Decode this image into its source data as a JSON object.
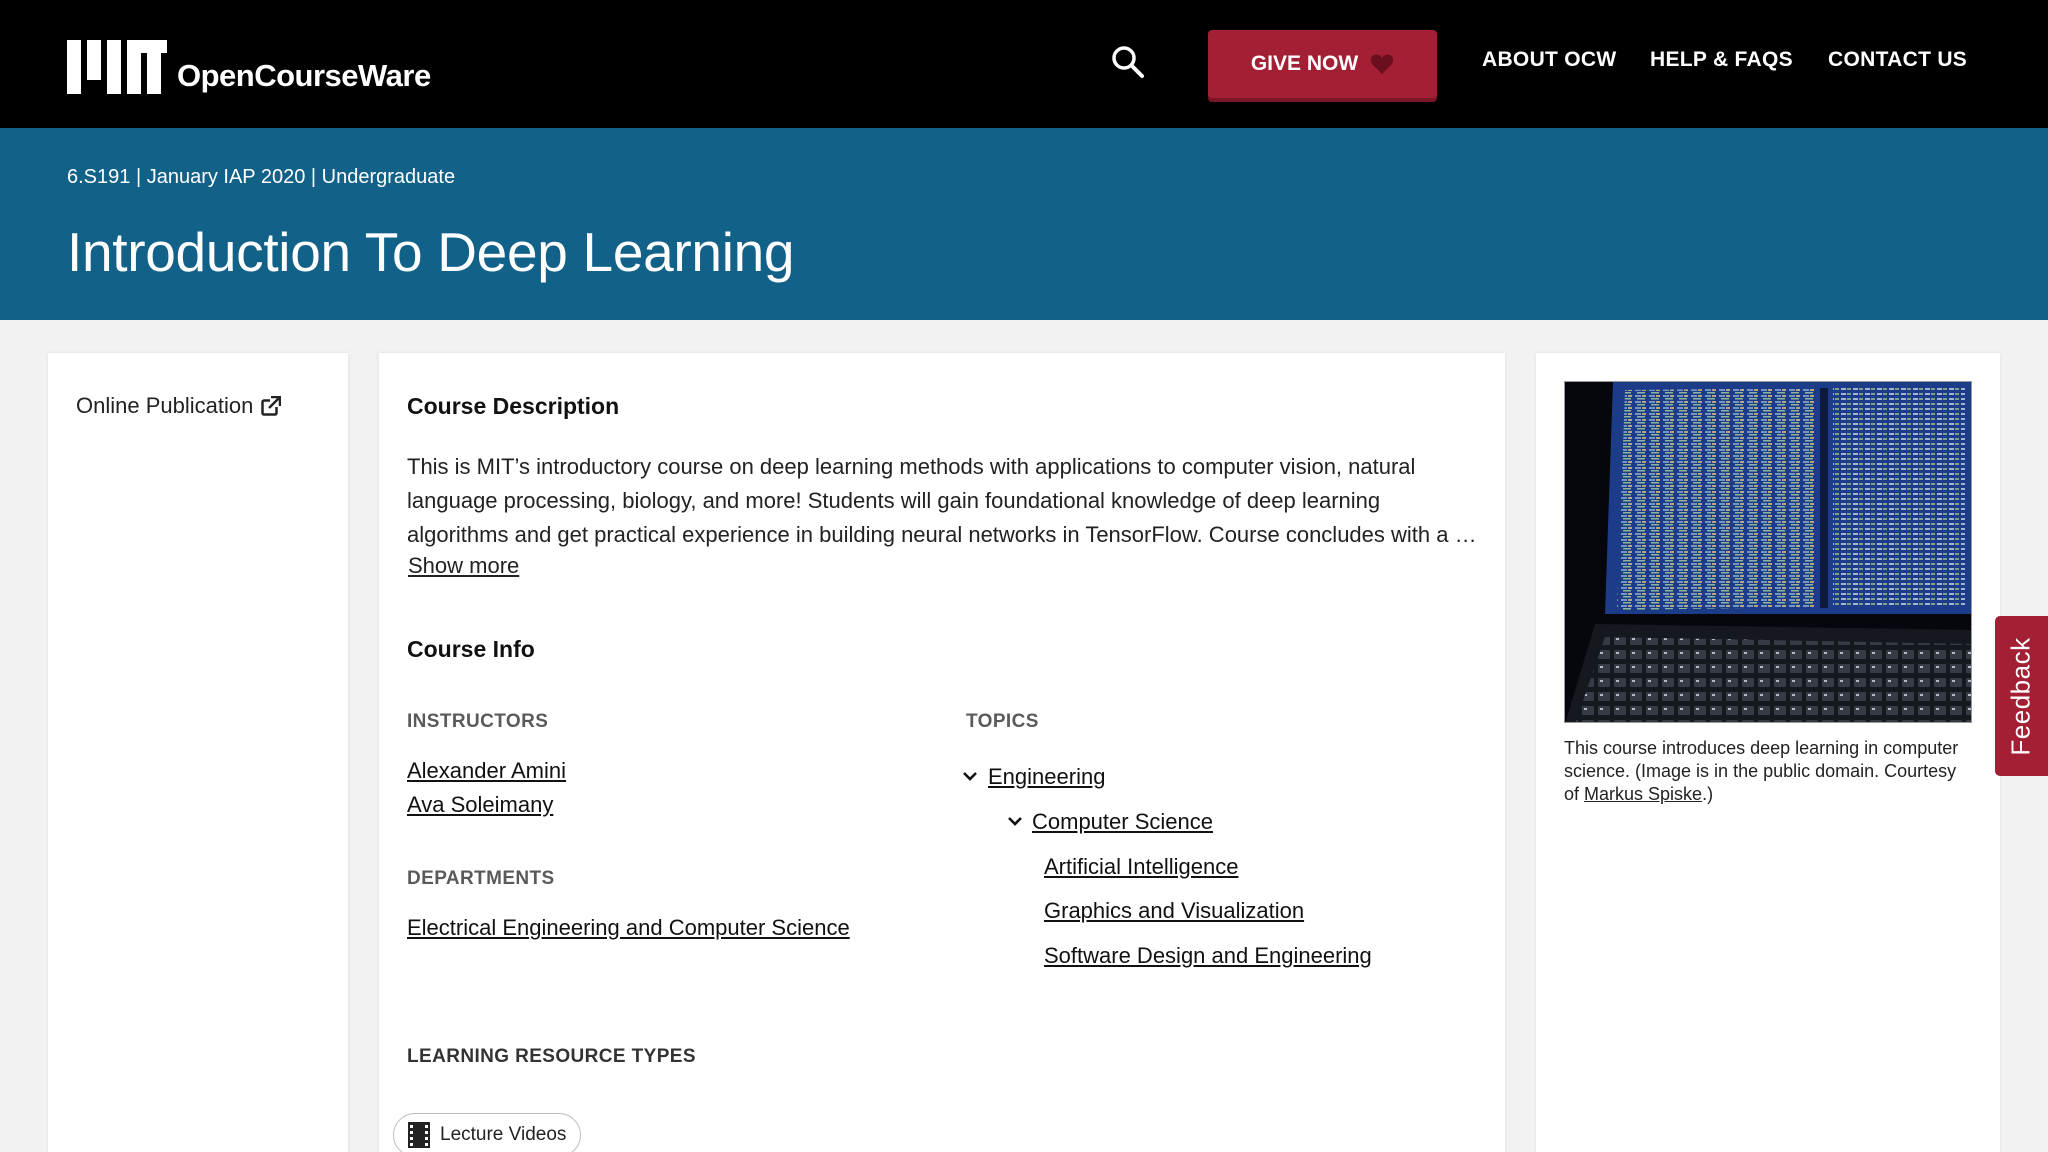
{
  "header": {
    "logo_text": "OpenCourseWare",
    "give_label": "GIVE NOW",
    "nav": [
      "ABOUT OCW",
      "HELP & FAQS",
      "CONTACT US"
    ]
  },
  "banner": {
    "meta": "6.S191 | January IAP 2020 | Undergraduate",
    "title": "Introduction To Deep Learning"
  },
  "sidebar": {
    "online_publication": "Online Publication"
  },
  "main": {
    "description_heading": "Course Description",
    "description": "This is MIT’s introductory course on deep learning methods with applications to computer vision, natural language processing, biology, and more! Students will gain foundational knowledge of deep learning algorithms and get practical experience in building neural networks in TensorFlow. Course concludes with a …",
    "show_more": "Show more",
    "course_info_heading": "Course Info",
    "instructors_label": "INSTRUCTORS",
    "instructors": [
      "Alexander Amini",
      "Ava Soleimany"
    ],
    "departments_label": "DEPARTMENTS",
    "departments": [
      "Electrical Engineering and Computer Science"
    ],
    "topics_label": "TOPICS",
    "topics": {
      "level1": "Engineering",
      "level2": "Computer Science",
      "level3": [
        "Artificial Intelligence",
        "Graphics and Visualization",
        "Software Design and Engineering"
      ]
    },
    "resource_types_label": "LEARNING RESOURCE TYPES",
    "resource_chip": "Lecture Videos"
  },
  "aside": {
    "caption_text": "This course introduces deep learning in computer science. (Image is in the public domain. Courtesy of ",
    "caption_link": "Markus Spiske",
    "caption_end": ".)"
  },
  "feedback_label": "Feedback",
  "colors": {
    "header_bg": "#000000",
    "banner_bg": "#126189",
    "accent": "#a31f34"
  }
}
